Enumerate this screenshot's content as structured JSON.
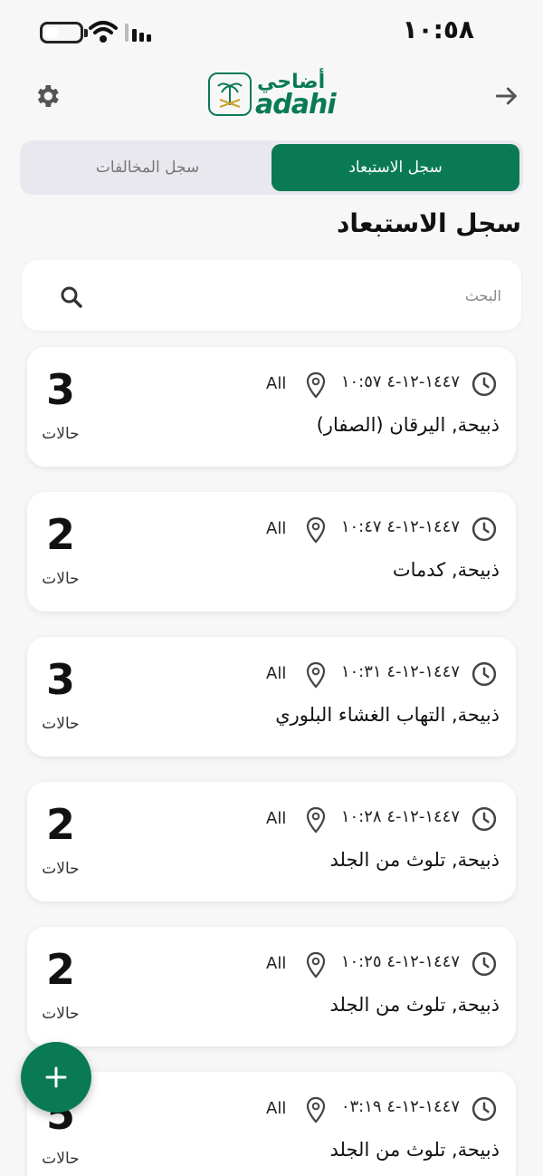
{
  "status": {
    "time": "١٠:٥٨"
  },
  "header": {
    "logo_ar": "أضاحي",
    "logo_en": "adahi"
  },
  "tabs": {
    "active_label": "سجل الاستبعاد",
    "inactive_label": "سجل المخالفات"
  },
  "section_title": "سجل الاستبعاد",
  "search": {
    "placeholder": "البحث",
    "value": ""
  },
  "cards": [
    {
      "count": "3",
      "count_label": "حالات",
      "datetime": "١٤٤٧-١٢-٤ ١٠:٥٧",
      "location": "All",
      "title": "ذبيحة, اليرقان (الصفار)"
    },
    {
      "count": "2",
      "count_label": "حالات",
      "datetime": "١٤٤٧-١٢-٤ ١٠:٤٧",
      "location": "All",
      "title": "ذبيحة, كدمات"
    },
    {
      "count": "3",
      "count_label": "حالات",
      "datetime": "١٤٤٧-١٢-٤ ١٠:٣١",
      "location": "All",
      "title": "ذبيحة, التهاب الغشاء البلوري"
    },
    {
      "count": "2",
      "count_label": "حالات",
      "datetime": "١٤٤٧-١٢-٤ ١٠:٢٨",
      "location": "All",
      "title": "ذبيحة, تلوث من الجلد"
    },
    {
      "count": "2",
      "count_label": "حالات",
      "datetime": "١٤٤٧-١٢-٤ ١٠:٢٥",
      "location": "All",
      "title": "ذبيحة, تلوث من الجلد"
    },
    {
      "count": "5",
      "count_label": "حالات",
      "datetime": "١٤٤٧-١٢-٤ ٠٣:١٩",
      "location": "All",
      "title": "ذبيحة, تلوث من الجلد"
    }
  ],
  "colors": {
    "brand": "#0a7a55",
    "background": "#f7f7f8"
  },
  "icons": [
    "battery-icon",
    "wifi-icon",
    "signal-icon",
    "gear-icon",
    "arrow-right-icon",
    "search-icon",
    "clock-icon",
    "location-pin-icon",
    "plus-icon"
  ]
}
